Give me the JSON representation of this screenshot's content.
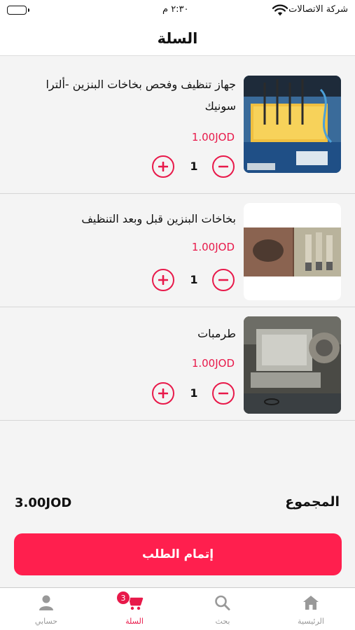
{
  "status_bar": {
    "carrier": "شركة الاتصالات",
    "time": "٢:٣٠ م"
  },
  "header": {
    "title": "السلة"
  },
  "cart": {
    "items": [
      {
        "name": "جهاز تنظيف وفحص بخاخات البنزين -ألترا سونيك",
        "price": "1.00JOD",
        "quantity": "1",
        "image": "fuel-injector-ultrasonic-cleaner-photo"
      },
      {
        "name": "بخاخات البنزين قبل وبعد التنظيف",
        "price": "1.00JOD",
        "quantity": "1",
        "image": "fuel-injectors-before-after-photo"
      },
      {
        "name": "طرمبات",
        "price": "1.00JOD",
        "quantity": "1",
        "image": "fuel-pump-photo"
      }
    ],
    "total_label": "المجموع",
    "total_value": "3.00JOD",
    "checkout_label": "إتمام الطلب"
  },
  "tabs": [
    {
      "label": "الرئيسية",
      "icon": "home-icon",
      "active": false
    },
    {
      "label": "بحث",
      "icon": "search-icon",
      "active": false
    },
    {
      "label": "السلة",
      "icon": "cart-icon",
      "active": true,
      "badge": "3"
    },
    {
      "label": "حسابي",
      "icon": "user-icon",
      "active": false
    }
  ],
  "colors": {
    "accent": "#e8194a",
    "checkout_button": "#ff1f4e",
    "background": "#f4f4f4",
    "inactive_tab": "#999999"
  }
}
